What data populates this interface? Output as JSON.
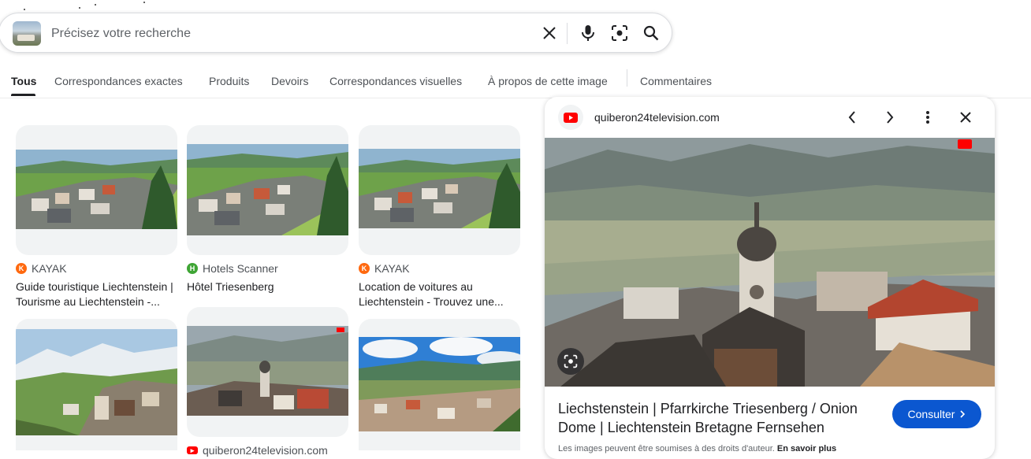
{
  "search": {
    "placeholder": "Précisez votre recherche"
  },
  "tabs": [
    {
      "label": "Tous",
      "active": true
    },
    {
      "label": "Correspondances exactes"
    },
    {
      "label": "Produits"
    },
    {
      "label": "Devoirs"
    },
    {
      "label": "Correspondances visuelles"
    },
    {
      "label": "À propos de cette image"
    },
    {
      "label": "Commentaires"
    }
  ],
  "results": [
    {
      "source": "KAYAK",
      "title": "Guide touristique Liechtenstein | Tourisme au Liechtenstein -..."
    },
    {
      "source": "Hotels Scanner",
      "title": "Hôtel Triesenberg"
    },
    {
      "source": "KAYAK",
      "title": "Location de voitures au Liechtenstein - Trouvez une..."
    },
    {
      "source": "",
      "title": ""
    },
    {
      "source": "quiberon24television.com",
      "title": ""
    },
    {
      "source": "",
      "title": ""
    }
  ],
  "panel": {
    "site": "quiberon24television.com",
    "title": "Liechstenstein | Pfarrkirche Triesenberg / Onion Dome | Liechtenstein Bretagne Fernsehen",
    "consult_label": "Consulter",
    "copyright_text": "Les images peuvent être soumises à des droits d'auteur.",
    "learn_more": "En savoir plus"
  },
  "colors": {
    "accent": "#0b57d0",
    "kayak": "#ff690f",
    "hotels_scanner": "#3fa535",
    "youtube": "#ff0000"
  }
}
